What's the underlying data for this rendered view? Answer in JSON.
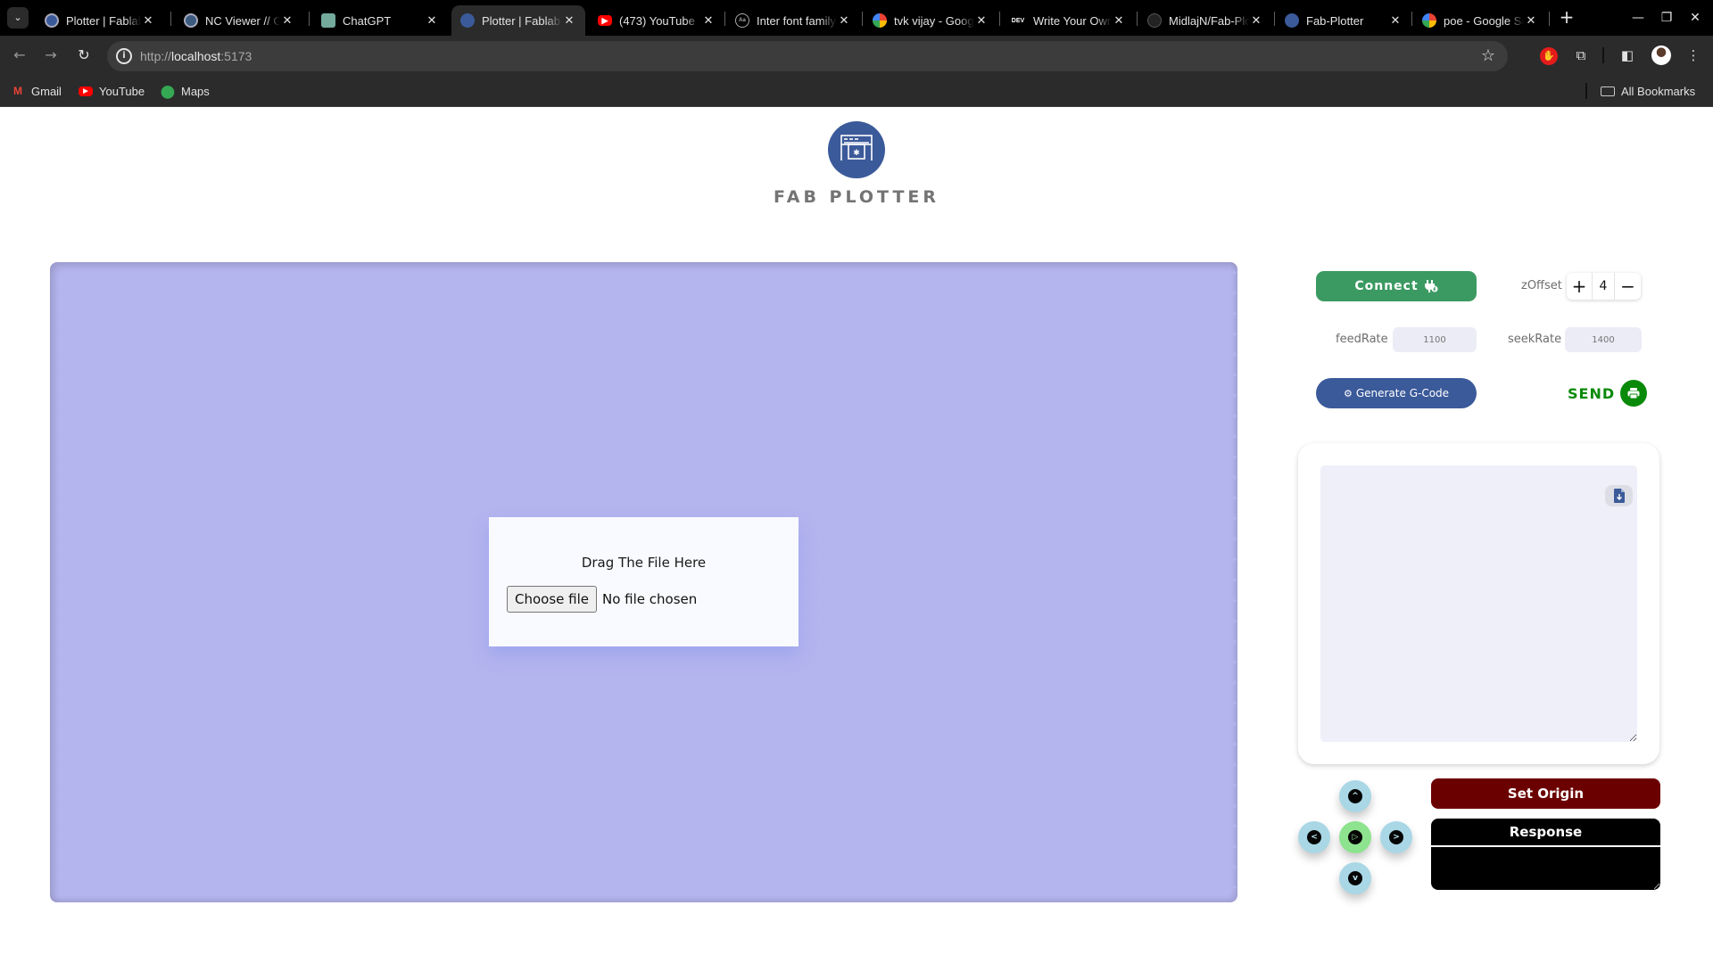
{
  "browser": {
    "tabs": [
      {
        "title": "Plotter | Fablab",
        "favicon": "fab-plotter-icon",
        "active": false
      },
      {
        "title": "NC Viewer // GCode",
        "favicon": "ncviewer-icon",
        "active": false
      },
      {
        "title": "ChatGPT",
        "favicon": "chatgpt-icon",
        "active": false
      },
      {
        "title": "Plotter | Fablab",
        "favicon": "fab-plotter-icon",
        "active": true
      },
      {
        "title": "(473) YouTube",
        "favicon": "youtube-icon",
        "active": false
      },
      {
        "title": "Inter font family",
        "favicon": "font-icon",
        "active": false
      },
      {
        "title": "tvk vijay - Google",
        "favicon": "google-icon",
        "active": false
      },
      {
        "title": "Write Your Own",
        "favicon": "dev-icon",
        "active": false
      },
      {
        "title": "MidlajN/Fab-Plotter",
        "favicon": "github-icon",
        "active": false
      },
      {
        "title": "Fab-Plotter",
        "favicon": "fab-plotter-icon",
        "active": false
      },
      {
        "title": "poe - Google Search",
        "favicon": "google-icon",
        "active": false
      }
    ],
    "url": {
      "scheme": "http://",
      "host": "localhost",
      "port": ":5173"
    },
    "bookmarks": [
      {
        "label": "Gmail",
        "icon": "gmail-icon"
      },
      {
        "label": "YouTube",
        "icon": "youtube-icon"
      },
      {
        "label": "Maps",
        "icon": "maps-icon"
      }
    ],
    "all_bookmarks_label": "All Bookmarks",
    "glyphs": {
      "tab_close": "✕",
      "new_tab": "+",
      "back": "←",
      "forward": "→",
      "reload": "↻",
      "star": "☆",
      "minimize": "—",
      "restore": "❐",
      "close": "✕",
      "menu": "⋮",
      "tab_overflow": "⌄",
      "info": "i"
    }
  },
  "app": {
    "brand": "FAB PLOTTER",
    "brand_color": "#3b5a9a",
    "dropzone": {
      "label": "Drag The File Here",
      "choose_button": "Choose file",
      "file_status": "No file chosen"
    },
    "controls": {
      "connect_label": "Connect",
      "zoffset_label": "zOffset",
      "zoffset_value": "4",
      "plus_glyph": "+",
      "minus_glyph": "−",
      "feedrate_label": "feedRate",
      "feedrate_placeholder": "1100",
      "seekrate_label": "seekRate",
      "seekrate_placeholder": "1400",
      "generate_label": "Generate G-Code",
      "send_label": "SEND"
    },
    "gcode": {
      "value": ""
    },
    "jog": {
      "up": "^",
      "down": "v",
      "left": "<",
      "right": ">",
      "center": "▷"
    },
    "set_origin_label": "Set Origin",
    "response_label": "Response",
    "response_value": "",
    "colors": {
      "connect": "#3b9a62",
      "generate": "#3b5a9a",
      "send": "#0a8a0a",
      "set_origin": "#6b0000",
      "jog": "#a9d7e6",
      "jog_center": "#8ee38e"
    }
  }
}
